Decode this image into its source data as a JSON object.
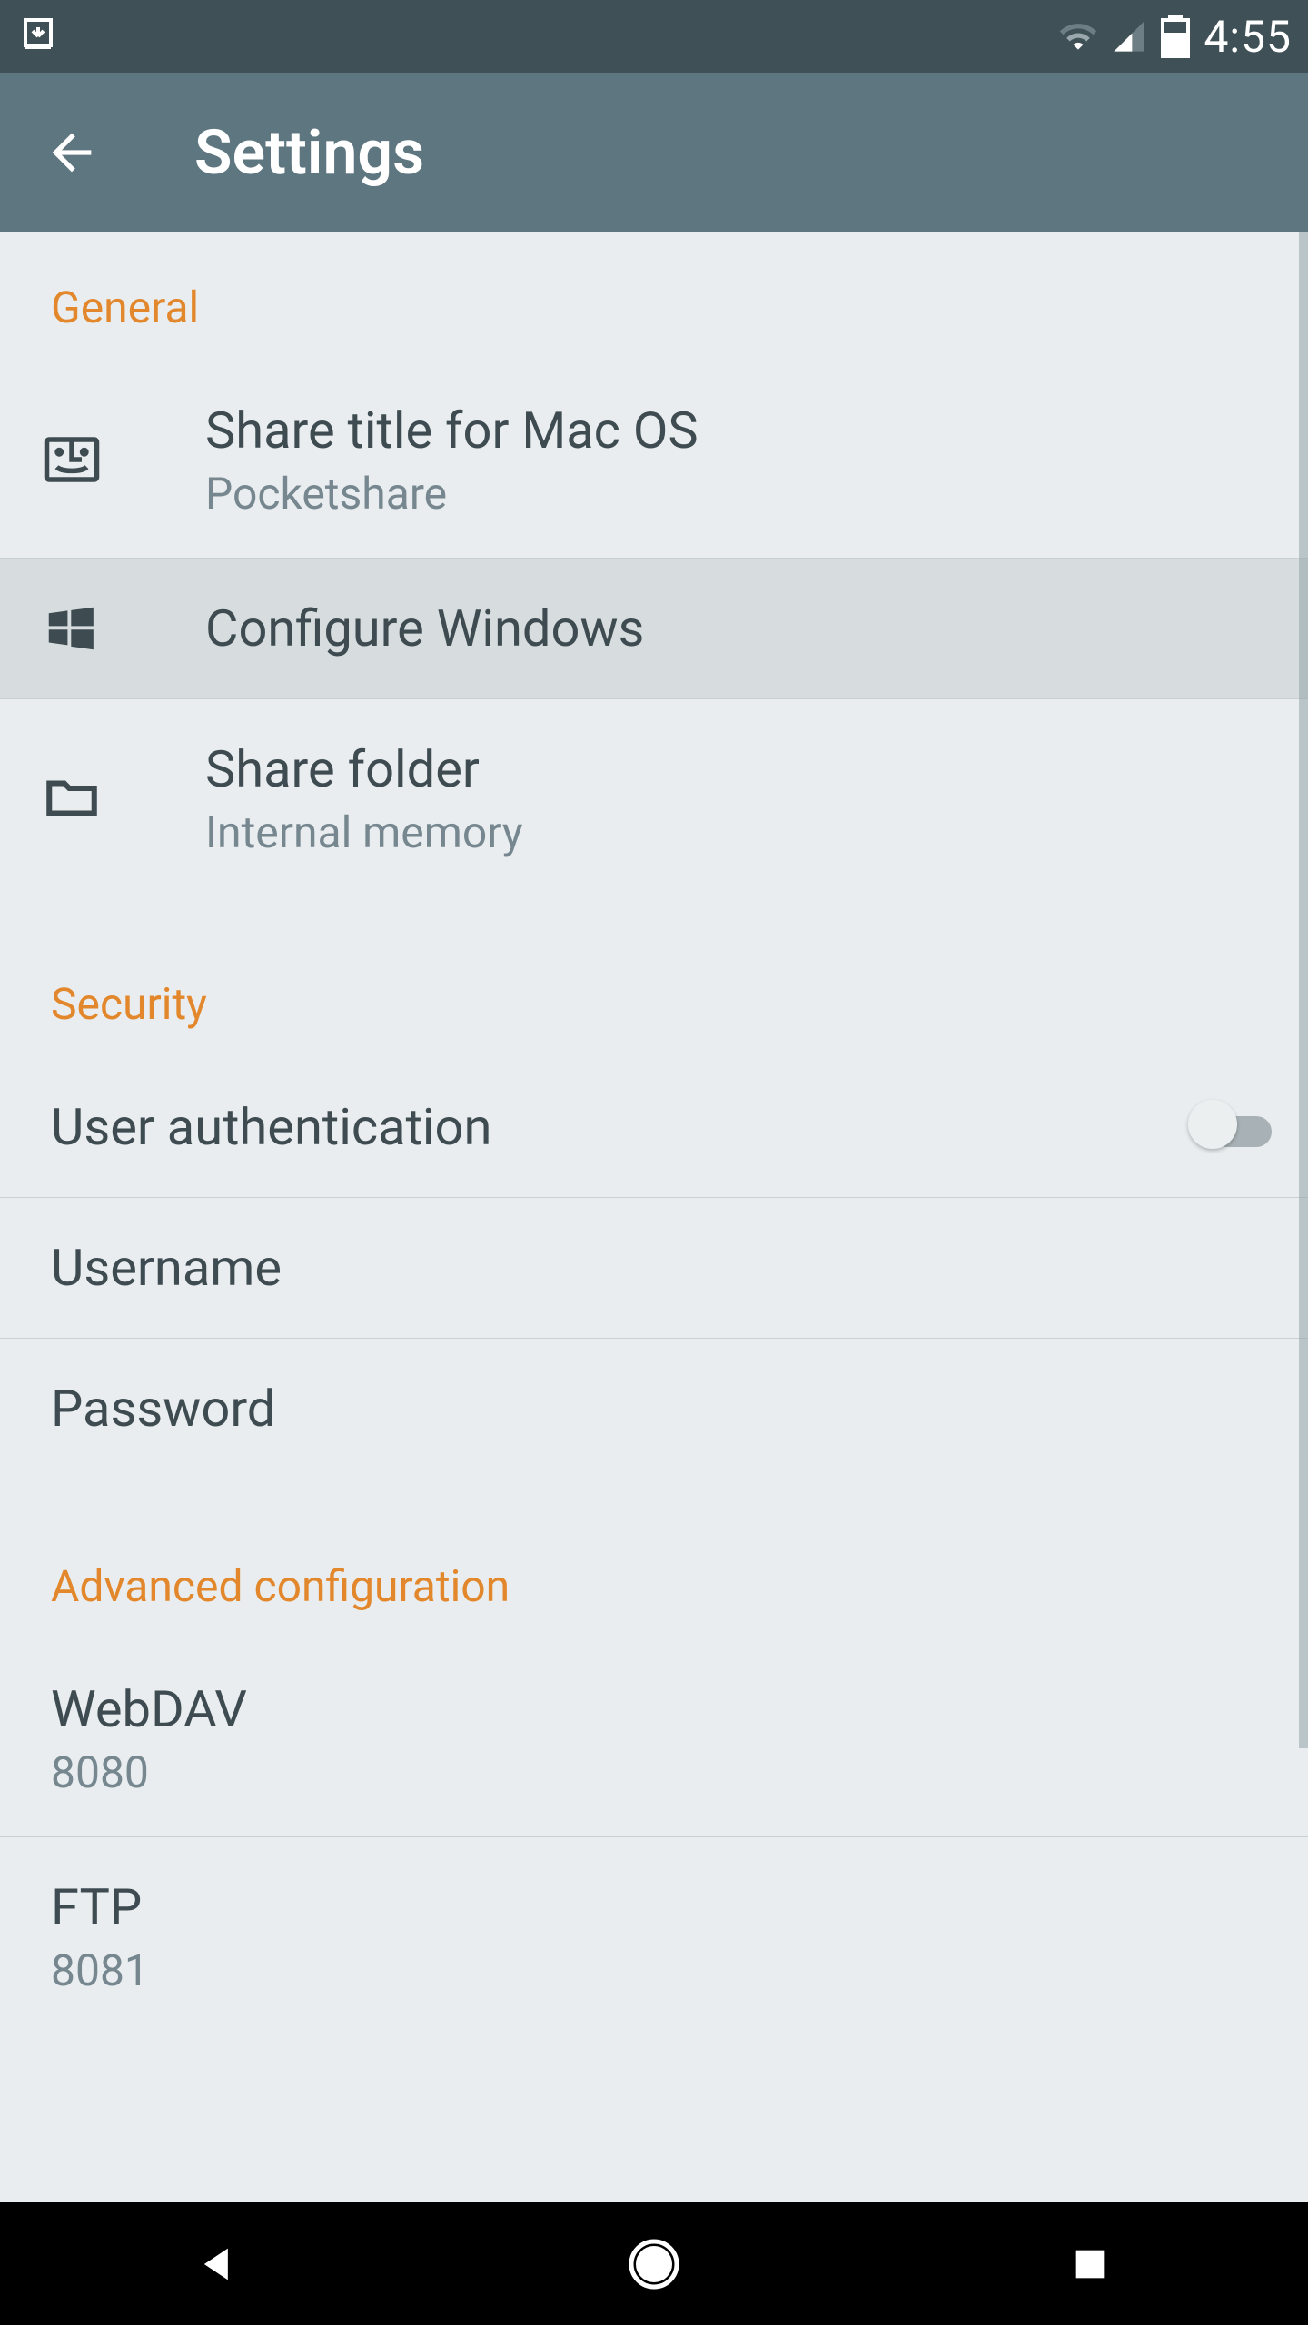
{
  "status": {
    "time": "4:55"
  },
  "appbar": {
    "title": "Settings"
  },
  "sections": {
    "general": {
      "header": "General",
      "shareTitle": {
        "title": "Share title for Mac OS",
        "sub": "Pocketshare"
      },
      "configureWindows": {
        "title": "Configure Windows"
      },
      "shareFolder": {
        "title": "Share folder",
        "sub": "Internal memory"
      }
    },
    "security": {
      "header": "Security",
      "userAuth": {
        "title": "User authentication"
      },
      "username": {
        "title": "Username"
      },
      "password": {
        "title": "Password"
      }
    },
    "advanced": {
      "header": "Advanced configuration",
      "webdav": {
        "title": "WebDAV",
        "sub": "8080"
      },
      "ftp": {
        "title": "FTP",
        "sub": "8081"
      }
    }
  }
}
